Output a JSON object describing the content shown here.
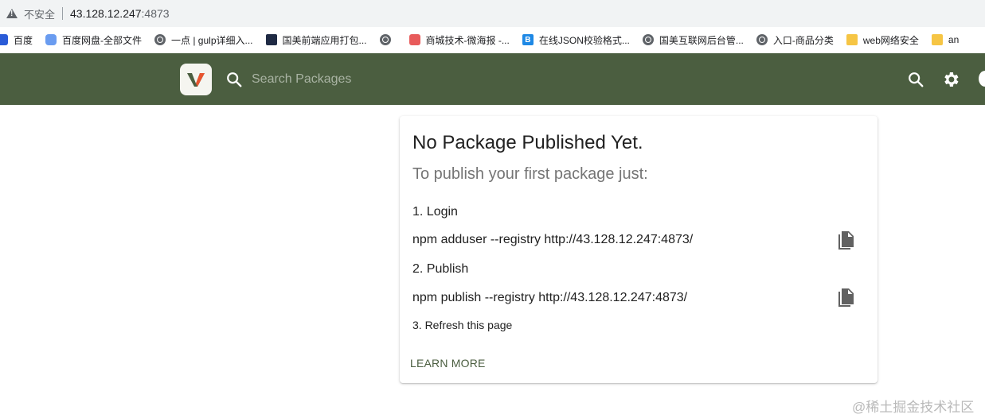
{
  "browser": {
    "security_label": "不安全",
    "url_host": "43.128.12.247",
    "url_port": ":4873"
  },
  "bookmarks": [
    {
      "label": "百度",
      "icon": "paw-icon"
    },
    {
      "label": "百度网盘-全部文件",
      "icon": "cloud-icon"
    },
    {
      "label": "一点 | gulp详细入...",
      "icon": "globe-icon"
    },
    {
      "label": "国美前端应用打包...",
      "icon": "image-icon"
    },
    {
      "label": "",
      "icon": "globe-icon"
    },
    {
      "label": "商城技术-微海报 -...",
      "icon": "dots-icon"
    },
    {
      "label": "在线JSON校验格式...",
      "icon": "bj-icon"
    },
    {
      "label": "国美互联网后台管...",
      "icon": "globe-icon"
    },
    {
      "label": "入口-商品分类",
      "icon": "globe-icon"
    },
    {
      "label": "web网络安全",
      "icon": "folder-icon"
    },
    {
      "label": "an",
      "icon": "folder-icon"
    }
  ],
  "header": {
    "search_placeholder": "Search Packages",
    "accent_color": "#4b5e40"
  },
  "card": {
    "title": "No Package Published Yet.",
    "subtitle": "To publish your first package just:",
    "step1": "1. Login",
    "cmd1": "npm adduser --registry http://43.128.12.247:4873/",
    "step2": "2. Publish",
    "cmd2": "npm publish --registry http://43.128.12.247:4873/",
    "step3": "3. Refresh this page",
    "learn_more": "LEARN MORE"
  },
  "watermark": "@稀土掘金技术社区"
}
